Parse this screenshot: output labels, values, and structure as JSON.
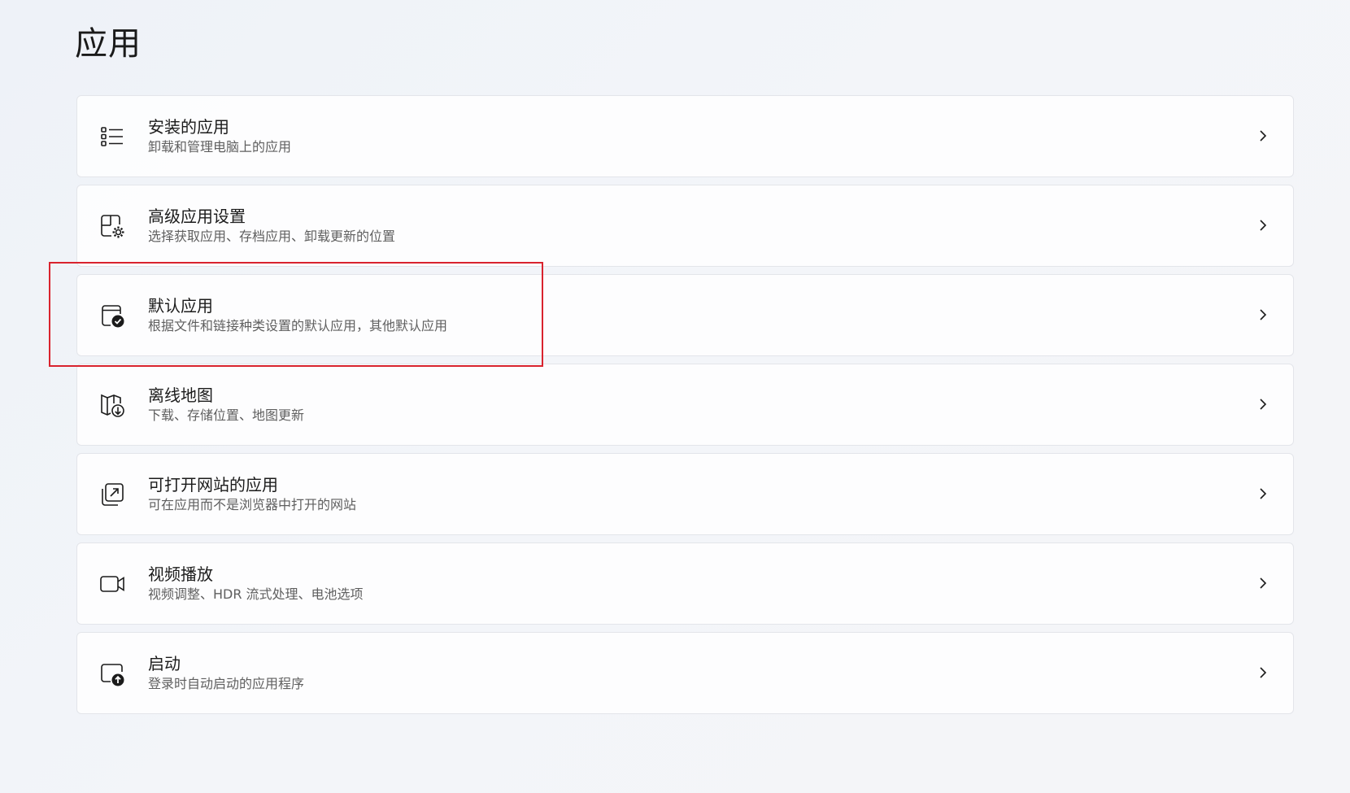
{
  "page": {
    "title": "应用"
  },
  "items": [
    {
      "title": "安装的应用",
      "desc": "卸载和管理电脑上的应用",
      "icon": "apps-list-icon"
    },
    {
      "title": "高级应用设置",
      "desc": "选择获取应用、存档应用、卸载更新的位置",
      "icon": "app-settings-gear-icon"
    },
    {
      "title": "默认应用",
      "desc": "根据文件和链接种类设置的默认应用，其他默认应用",
      "icon": "default-app-check-icon"
    },
    {
      "title": "离线地图",
      "desc": "下载、存储位置、地图更新",
      "icon": "offline-map-download-icon"
    },
    {
      "title": "可打开网站的应用",
      "desc": "可在应用而不是浏览器中打开的网站",
      "icon": "open-website-icon"
    },
    {
      "title": "视频播放",
      "desc": "视频调整、HDR 流式处理、电池选项",
      "icon": "video-camera-icon"
    },
    {
      "title": "启动",
      "desc": "登录时自动启动的应用程序",
      "icon": "startup-app-icon"
    }
  ],
  "highlight": {
    "color": "#d9232e",
    "target": "默认应用"
  },
  "colors": {
    "background": "#f1f4f8",
    "card": "#ffffff",
    "text": "#1b1b1b",
    "secondary_text": "#5f5f5f",
    "accent_check": "#1b1b1b"
  }
}
